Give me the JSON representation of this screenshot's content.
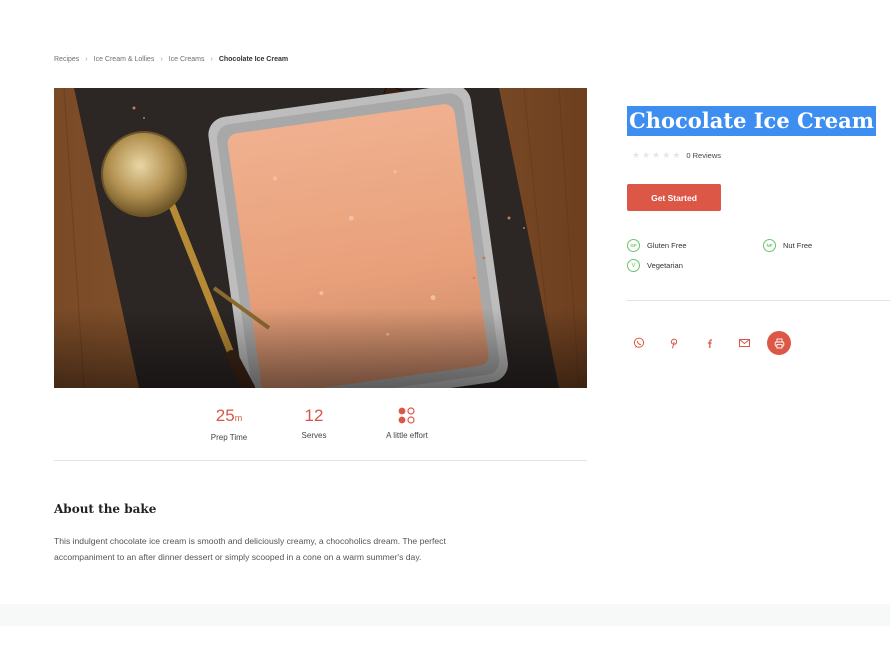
{
  "breadcrumb": {
    "items": [
      "Recipes",
      "Ice Cream & Lollies",
      "Ice Creams"
    ],
    "current": "Chocolate Ice Cream",
    "separator": "›"
  },
  "hero": {
    "image_icon": "ice-cream-loaf-tin-photo"
  },
  "stats": {
    "prep_value": "25",
    "prep_unit": "m",
    "prep_label": "Prep Time",
    "serves_value": "12",
    "serves_label": "Serves",
    "effort_icon": "effort-dots-icon",
    "effort_label": "A little effort"
  },
  "about": {
    "title": "About the bake",
    "line1": "This indulgent chocolate ice cream is smooth and deliciously creamy, a chocoholics dream. The perfect",
    "line2": "accompaniment to an after dinner dessert or simply scooped in a cone on a warm summer's day."
  },
  "recipe": {
    "title": "Chocolate Ice Cream",
    "rating_stars": 0,
    "reviews": "0 Reviews",
    "cta": "Get Started"
  },
  "diets": [
    {
      "badge": "GF",
      "label": "Gluten Free"
    },
    {
      "badge": "NF",
      "label": "Nut Free"
    },
    {
      "badge": "V",
      "label": "Vegetarian"
    }
  ],
  "share": [
    "whatsapp-icon",
    "pinterest-icon",
    "facebook-icon",
    "email-icon",
    "print-icon"
  ],
  "colors": {
    "accent": "#dc5746",
    "diet_green": "#6bc46b",
    "title_highlight": "#3d8ef0"
  }
}
